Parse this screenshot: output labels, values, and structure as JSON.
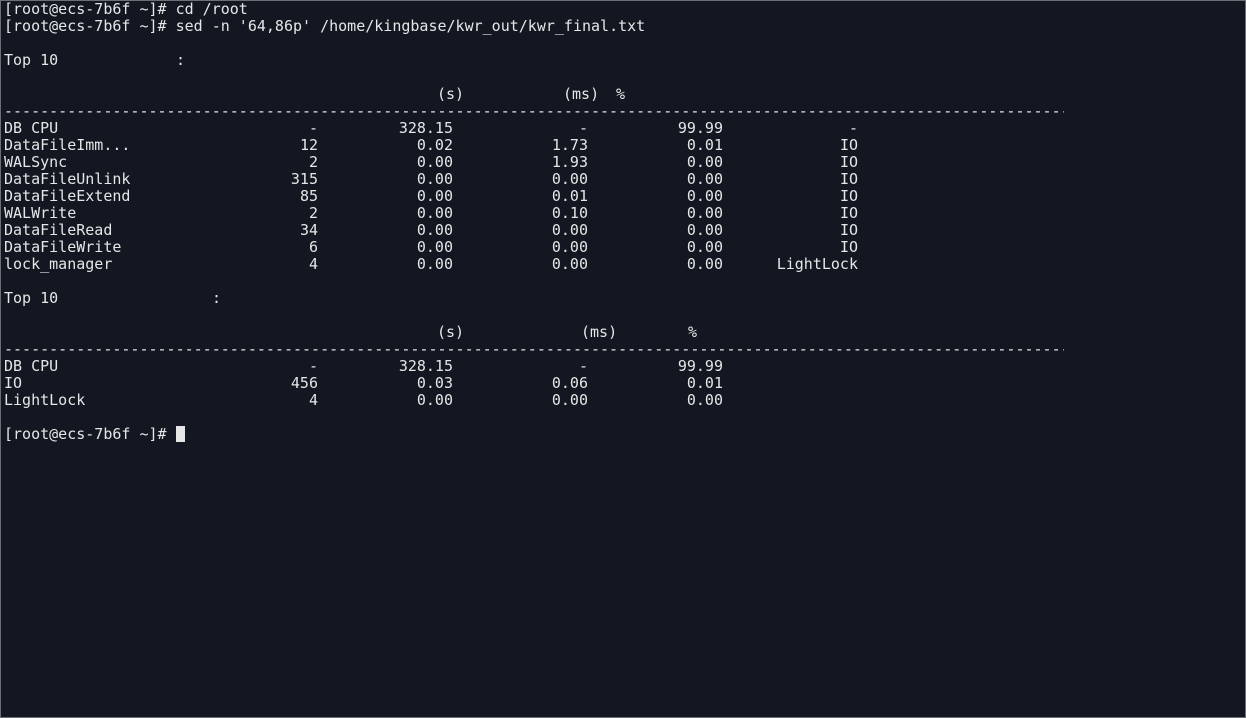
{
  "prompt": "[root@ecs-7b6f ~]#",
  "commands": [
    "cd /root",
    "sed -n '64,86p' /home/kingbase/kwr_out/kwr_final.txt"
  ],
  "section1": {
    "title": "Top 10",
    "colon": ":",
    "headers": {
      "s": "(s)",
      "ms": "(ms)",
      "pct": "%"
    },
    "separator": "----------------------------------------------------------------------------------------------------------------------",
    "rows": [
      {
        "name": "DB CPU",
        "count": "-",
        "time": "328.15",
        "avg": "-",
        "pct": "99.99",
        "cls": "-"
      },
      {
        "name": "DataFileImm...",
        "count": "12",
        "time": "0.02",
        "avg": "1.73",
        "pct": "0.01",
        "cls": "IO"
      },
      {
        "name": "WALSync",
        "count": "2",
        "time": "0.00",
        "avg": "1.93",
        "pct": "0.00",
        "cls": "IO"
      },
      {
        "name": "DataFileUnlink",
        "count": "315",
        "time": "0.00",
        "avg": "0.00",
        "pct": "0.00",
        "cls": "IO"
      },
      {
        "name": "DataFileExtend",
        "count": "85",
        "time": "0.00",
        "avg": "0.01",
        "pct": "0.00",
        "cls": "IO"
      },
      {
        "name": "WALWrite",
        "count": "2",
        "time": "0.00",
        "avg": "0.10",
        "pct": "0.00",
        "cls": "IO"
      },
      {
        "name": "DataFileRead",
        "count": "34",
        "time": "0.00",
        "avg": "0.00",
        "pct": "0.00",
        "cls": "IO"
      },
      {
        "name": "DataFileWrite",
        "count": "6",
        "time": "0.00",
        "avg": "0.00",
        "pct": "0.00",
        "cls": "IO"
      },
      {
        "name": "lock_manager",
        "count": "4",
        "time": "0.00",
        "avg": "0.00",
        "pct": "0.00",
        "cls": "LightLock"
      }
    ]
  },
  "section2": {
    "title": "Top 10",
    "colon": ":",
    "headers": {
      "s": "(s)",
      "ms": "(ms)",
      "pct": "%"
    },
    "separator": "----------------------------------------------------------------------------------------------------------------------",
    "rows": [
      {
        "name": "DB CPU",
        "count": "-",
        "time": "328.15",
        "avg": "-",
        "pct": "99.99"
      },
      {
        "name": "IO",
        "count": "456",
        "time": "0.03",
        "avg": "0.06",
        "pct": "0.01"
      },
      {
        "name": "LightLock",
        "count": "4",
        "time": "0.00",
        "avg": "0.00",
        "pct": "0.00"
      }
    ]
  }
}
